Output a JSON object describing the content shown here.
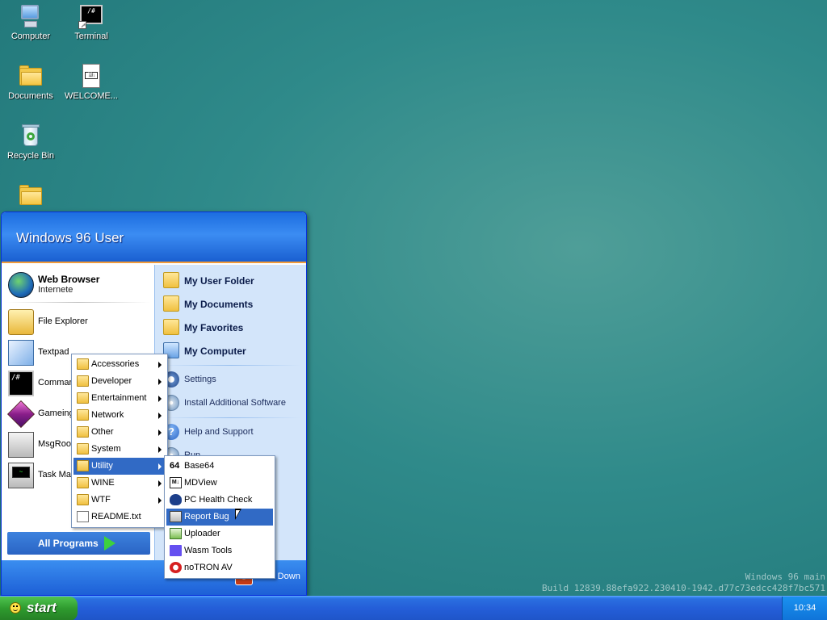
{
  "desktop": {
    "icons": [
      {
        "label": "Computer"
      },
      {
        "label": "Terminal",
        "glyph": "/#"
      },
      {
        "label": "Documents"
      },
      {
        "label": "WELCOME..."
      },
      {
        "label": "Recycle Bin"
      },
      {
        "label": ""
      }
    ]
  },
  "start_menu": {
    "user_name": "Windows 96 User",
    "pinned": {
      "title": "Web Browser",
      "subtitle": "Internete"
    },
    "recent": [
      {
        "label": "File Explorer"
      },
      {
        "label": "Textpad"
      },
      {
        "label": "Command"
      },
      {
        "label": "Gameing"
      },
      {
        "label": "MsgRoom"
      },
      {
        "label": "Task Mar"
      }
    ],
    "cmd_glyph": "/#",
    "all_programs_label": "All Programs",
    "places": [
      {
        "label": "My User Folder"
      },
      {
        "label": "My Documents"
      },
      {
        "label": "My Favorites"
      },
      {
        "label": "My Computer"
      }
    ],
    "system": [
      {
        "label": "Settings"
      },
      {
        "label": "Install Additional Software"
      }
    ],
    "help": [
      {
        "label": "Help and Support",
        "glyph": "?"
      },
      {
        "label": "Run..."
      }
    ],
    "shutdown_label": "Shut Down"
  },
  "programs_menu": {
    "items": [
      {
        "label": "Accessories"
      },
      {
        "label": "Developer"
      },
      {
        "label": "Entertainment"
      },
      {
        "label": "Network"
      },
      {
        "label": "Other"
      },
      {
        "label": "System"
      },
      {
        "label": "Utility"
      },
      {
        "label": "WINE"
      },
      {
        "label": "WTF"
      },
      {
        "label": "README.txt"
      }
    ],
    "selected": "Utility"
  },
  "utility_menu": {
    "items": [
      {
        "label": "Base64",
        "glyph": "64"
      },
      {
        "label": "MDView",
        "glyph": "M↓"
      },
      {
        "label": "PC Health Check"
      },
      {
        "label": "Report Bug"
      },
      {
        "label": "Uploader"
      },
      {
        "label": "Wasm Tools"
      },
      {
        "label": "noTRON AV"
      }
    ],
    "selected": "Report Bug"
  },
  "taskbar": {
    "start_label": "start",
    "clock": "10:34"
  },
  "watermark": {
    "line1": "Windows 96 main",
    "line2": "Build 12839.88efa922.230410-1942.d77c73edcc428f7bc571"
  },
  "colors": {
    "selection": "#316ac5",
    "taskbar": "#245ed8",
    "start_button": "#2e9a2e",
    "desktop": "#2f8a8a"
  }
}
